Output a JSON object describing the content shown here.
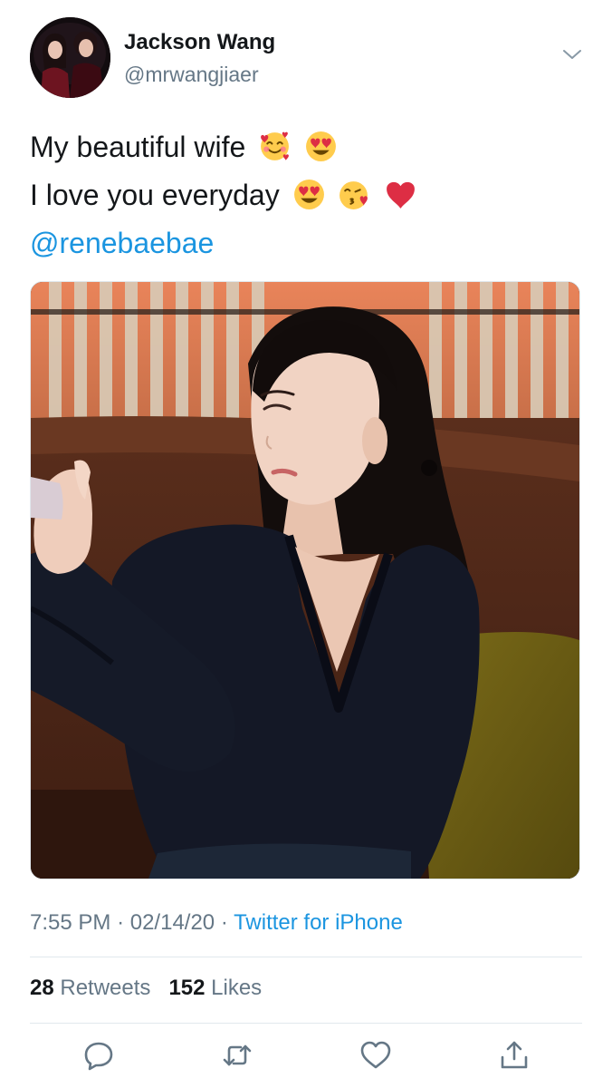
{
  "author": {
    "display_name": "Jackson Wang",
    "handle": "@mrwangjiaer",
    "avatar_icon": "profile-photo"
  },
  "tweet": {
    "line1": "My beautiful wife",
    "line1_emojis": [
      "smiling-face-with-hearts",
      "heart-eyes"
    ],
    "line2": "I love you everyday",
    "line2_emojis": [
      "heart-eyes",
      "face-blowing-kiss",
      "red-heart"
    ],
    "mention": "@renebaebae"
  },
  "meta": {
    "time": "7:55 PM",
    "date": "02/14/20",
    "separator": "·",
    "source": "Twitter for iPhone"
  },
  "stats": {
    "retweets_count": "28",
    "retweets_label": "Retweets",
    "likes_count": "152",
    "likes_label": "Likes"
  },
  "colors": {
    "link": "#1b95e0",
    "secondary_text": "#657786",
    "primary_text": "#14171a",
    "divider": "#e1e8ed"
  }
}
